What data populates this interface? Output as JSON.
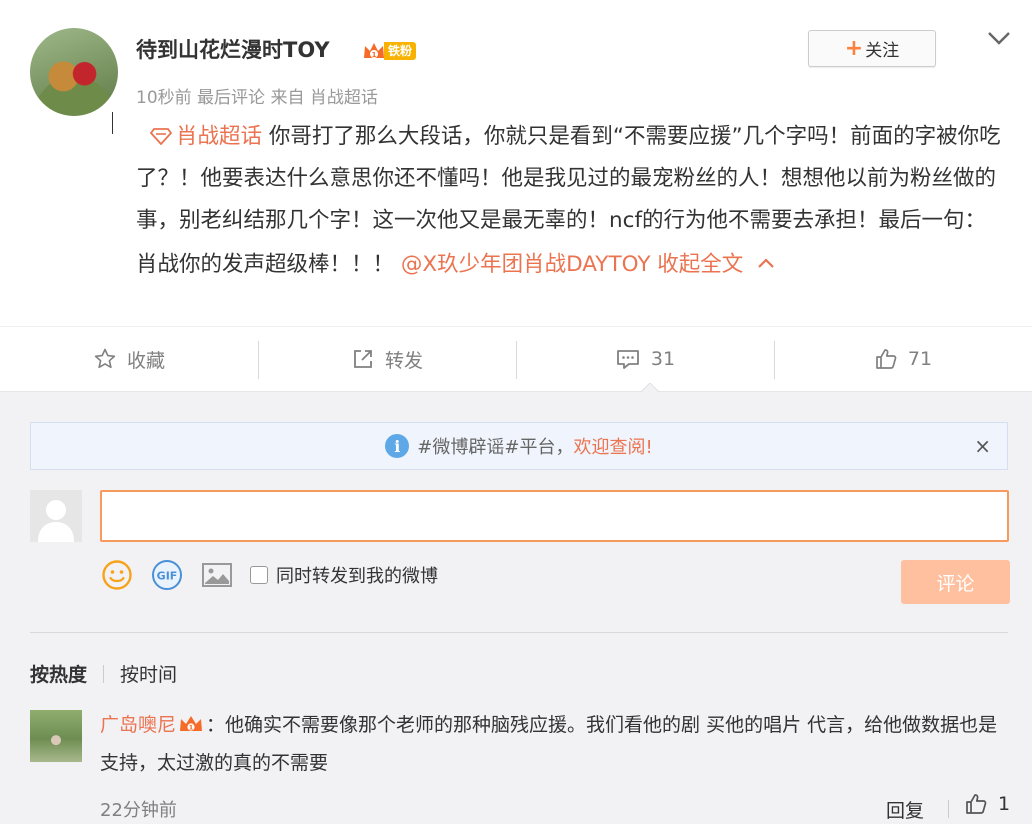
{
  "post": {
    "username": "待到山花烂漫时TOY",
    "fan_badge": "铁粉",
    "meta": "10秒前 最后评论 来自 肖战超话",
    "follow_label": "关注",
    "topic_link": "肖战超话",
    "body_text": "你哥打了那么大段话，你就只是看到“不需要应援”几个字吗！前面的字被你吃了？！他要表达什么意思你还不懂吗！他是我见过的最宠粉丝的人！想想他以前为粉丝做的事，别老纠结那几个字！这一次他又是最无辜的！ncf的行为他不需要去承担！最后一句：肖战你的发声超级棒！！！",
    "mention": "@X玖少年团肖战DAYTOY",
    "collapse_label": "收起全文"
  },
  "actions": {
    "favorite_label": "收藏",
    "repost_label": "转发",
    "comment_count": "31",
    "like_count": "71"
  },
  "notice": {
    "prefix": "#微博辟谣#平台，",
    "link": "欢迎查阅!",
    "close": "×"
  },
  "composer": {
    "input_value": "",
    "repost_label": "同时转发到我的微博",
    "submit_label": "评论"
  },
  "sort": {
    "hot": "按热度",
    "time": "按时间"
  },
  "comment": {
    "name": "广岛噢尼",
    "colon": "：",
    "text": "他确实不需要像那个老师的那种脑残应援。我们看他的剧 买他的唱片 代言，给他做数据也是支持，太过激的真的不需要",
    "time": "22分钟前",
    "reply_label": "回复",
    "like_count": "1"
  },
  "colors": {
    "accent": "#eb7350",
    "follow_plus": "#ff8140",
    "submit_bg": "#ffc09f",
    "input_border": "#f79a5d"
  }
}
